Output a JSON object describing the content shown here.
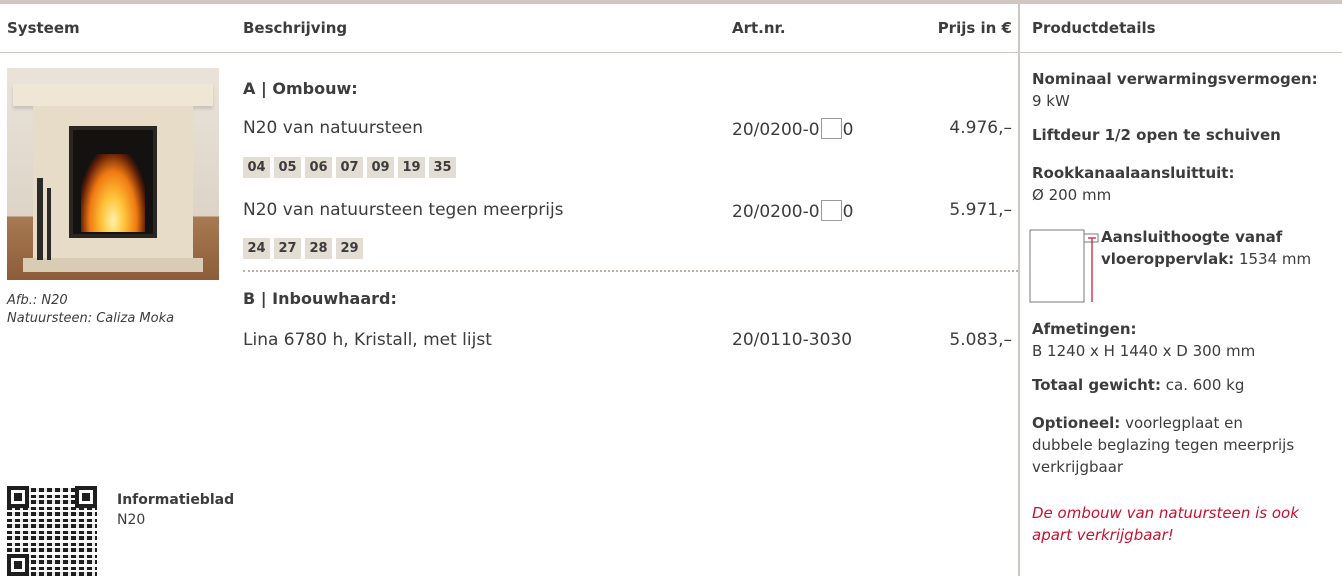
{
  "header": {
    "systeem": "Systeem",
    "beschrijving": "Beschrijving",
    "artnr": "Art.nr.",
    "prijs": "Prijs in €",
    "productdetails": "Productdetails"
  },
  "image": {
    "caption_line1": "Afb.: N20",
    "caption_line2": "Natuursteen: Caliza Moka"
  },
  "section_a": {
    "title": "A | Ombouw:",
    "rows": [
      {
        "description": "N20 van natuursteen",
        "artnr_prefix": "20/0200-0",
        "artnr_suffix": "0",
        "price": "4.976,–",
        "codes": [
          "04",
          "05",
          "06",
          "07",
          "09",
          "19",
          "35"
        ]
      },
      {
        "description": "N20 van natuursteen tegen meerprijs",
        "artnr_prefix": "20/0200-0",
        "artnr_suffix": "0",
        "price": "5.971,–",
        "codes": [
          "24",
          "27",
          "28",
          "29"
        ]
      }
    ]
  },
  "section_b": {
    "title": "B | Inbouwhaard:",
    "rows": [
      {
        "description": "Lina 6780 h, Kristall, met lijst",
        "artnr": "20/0110-3030",
        "price": "5.083,–"
      }
    ]
  },
  "info": {
    "title": "Informatieblad",
    "subtitle": "N20"
  },
  "productdetails": {
    "power_label": "Nominaal verwarmingsvermogen:",
    "power_value": "9 kW",
    "door": "Liftdeur 1/2 open te schuiven",
    "flue_label": "Rookkanaalaansluittuit:",
    "flue_value": "Ø 200 mm",
    "height_label_1": "Aansluithoogte vanaf",
    "height_label_2": "vloeroppervlak:",
    "height_value": "1534 mm",
    "dims_label": "Afmetingen:",
    "dims_value": "B 1240 x H 1440 x D 300 mm",
    "weight_label": "Totaal gewicht:",
    "weight_value": "ca. 600 kg",
    "optional_label": "Optioneel:",
    "optional_line1": "voorlegplaat en",
    "optional_line2": "dubbele beglazing tegen meerprijs",
    "optional_line3": "verkrijgbaar",
    "note_line1": "De ombouw van natuursteen is ook",
    "note_line2": "apart verkrijgbaar!"
  },
  "colors": {
    "accent_red": "#c8102e",
    "chip_bg": "#e4ddd4",
    "rule": "#cfc7c0"
  }
}
